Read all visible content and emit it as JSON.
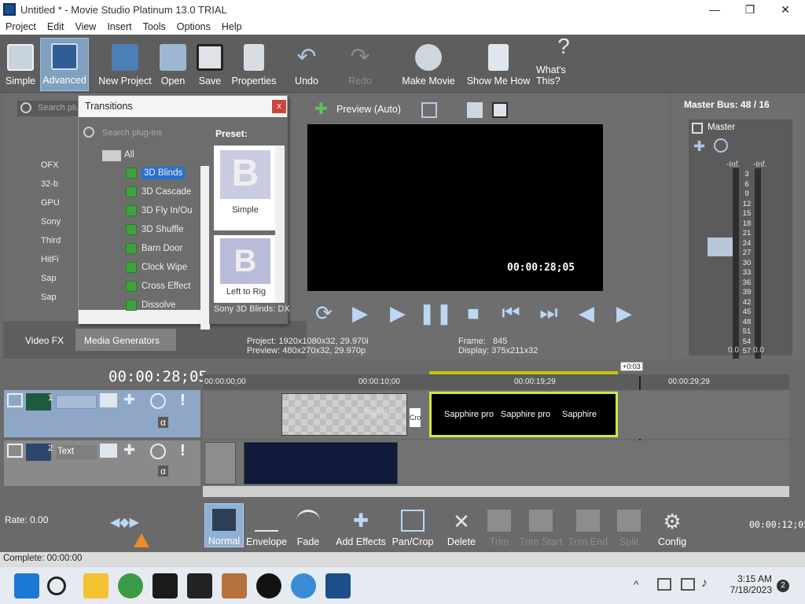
{
  "window": {
    "title": "Untitled * - Movie Studio Platinum 13.0 TRIAL",
    "min": "—",
    "max": "❐",
    "close": "✕"
  },
  "menu": [
    "Project",
    "Edit",
    "View",
    "Insert",
    "Tools",
    "Options",
    "Help"
  ],
  "toolbar": {
    "simple": "Simple",
    "advanced": "Advanced",
    "new_project": "New Project",
    "open": "Open",
    "save": "Save",
    "properties": "Properties",
    "undo": "Undo",
    "redo": "Redo",
    "make_movie": "Make Movie",
    "show_me_how": "Show Me How",
    "whats_this": "What's This?"
  },
  "left_panel": {
    "search_placeholder": "Search plu",
    "folders": [
      "OFX",
      "32-b",
      "GPU",
      "Sony",
      "Third",
      "HitFi",
      "Sap",
      "Sap"
    ],
    "tabs": [
      "Video FX",
      "Media Generators"
    ]
  },
  "transitions": {
    "title": "Transitions",
    "close": "x",
    "search_placeholder": "Search plug-ins",
    "root": "All",
    "items": [
      "3D Blinds",
      "3D Cascade",
      "3D Fly In/Ou",
      "3D Shuffle",
      "Barn Door",
      "Clock Wipe",
      "Cross Effect",
      "Dissolve"
    ],
    "selected": "3D Blinds",
    "preset_label": "Preset:",
    "presets": [
      "Simple",
      "Left to Rig"
    ],
    "footer": "Sony 3D Blinds: DX"
  },
  "preview": {
    "mode": "Preview (Auto)",
    "timecode": "00:00:28;05",
    "project_label": "Project:",
    "project_value": "1920x1080x32, 29.970i",
    "preview_label": "Preview:",
    "preview_value": "480x270x32, 29.970p",
    "frame_label": "Frame:",
    "frame_value": "845",
    "display_label": "Display:",
    "display_value": "375x211x32"
  },
  "master": {
    "title": "Master Bus:",
    "ratio": "48 / 16",
    "label": "Master",
    "peak_left": "-Inf.",
    "peak_right": "-Inf.",
    "scale": [
      "3",
      "6",
      "9",
      "12",
      "15",
      "18",
      "21",
      "24",
      "27",
      "30",
      "33",
      "36",
      "39",
      "42",
      "45",
      "48",
      "51",
      "54",
      "57"
    ],
    "bottom_left": "0.0",
    "bottom_right": "0.0"
  },
  "timeline": {
    "cursor_time": "00:00:28;05",
    "ruler": [
      "00:00:00;00",
      "00:00:10;00",
      "00:00:19;29",
      "00:00:29;29"
    ],
    "offset_badge": "+0:03",
    "track1_number": "1",
    "track2_number": "2",
    "track2_name": "Text",
    "clip_labels": [
      "Cro",
      "Sapphire pro",
      "Sapphire pro",
      "Sapphire"
    ],
    "clip_ghost": "Sapph",
    "rate_label": "Rate: 0.00"
  },
  "edit_tools": {
    "normal": "Normal",
    "envelope": "Envelope",
    "fade": "Fade",
    "add_effects": "Add Effects",
    "pan_crop": "Pan/Crop",
    "delete": "Delete",
    "trim": "Trim",
    "trim_start": "Trim Start",
    "trim_end": "Trim End",
    "split": "Split",
    "config": "Config",
    "time_readout": "00:00:12;05"
  },
  "status": {
    "complete": "Complete: 00:00:00"
  },
  "taskbar": {
    "time": "3:15 AM",
    "date": "7/18/2023",
    "notif_count": "2"
  }
}
